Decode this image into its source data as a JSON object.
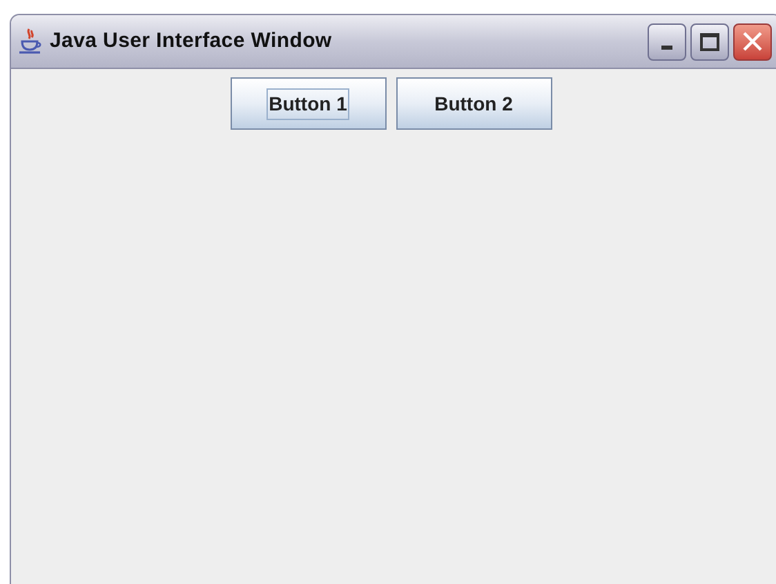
{
  "window": {
    "title": "Java User Interface Window"
  },
  "buttons": [
    {
      "label": "Button 1",
      "focused": true
    },
    {
      "label": "Button 2",
      "focused": false
    }
  ]
}
